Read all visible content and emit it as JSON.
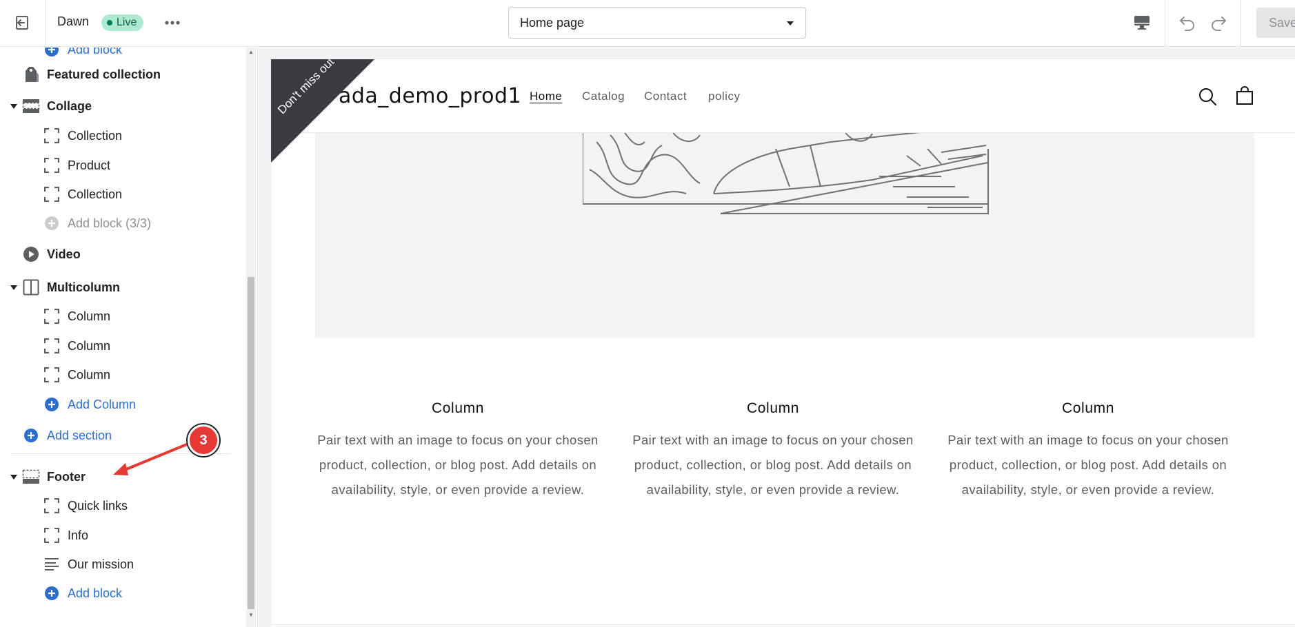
{
  "topbar": {
    "theme_name": "Dawn",
    "live_label": "Live",
    "page_select": "Home page",
    "save_label": "Save"
  },
  "sidebar": {
    "cut_item": "Add block",
    "featured_collection": "Featured collection",
    "collage": {
      "label": "Collage",
      "blocks": [
        "Collection",
        "Product",
        "Collection"
      ],
      "add_block": "Add block (3/3)"
    },
    "video": "Video",
    "multicolumn": {
      "label": "Multicolumn",
      "blocks": [
        "Column",
        "Column",
        "Column"
      ],
      "add_column": "Add Column"
    },
    "add_section": "Add section",
    "footer": {
      "label": "Footer",
      "blocks": [
        "Quick links",
        "Info",
        "Our mission"
      ],
      "add_block": "Add block"
    }
  },
  "annotation": {
    "number": "3"
  },
  "preview": {
    "ribbon_text": "Don't miss out",
    "store_name": "ada_demo_prod1",
    "nav": [
      "Home",
      "Catalog",
      "Contact",
      "policy"
    ],
    "columns": [
      {
        "title": "Column",
        "text": "Pair text with an image to focus on your chosen product, collection, or blog post. Add details on availability, style, or even provide a review."
      },
      {
        "title": "Column",
        "text": "Pair text with an image to focus on your chosen product, collection, or blog post. Add details on availability, style, or even provide a review."
      },
      {
        "title": "Column",
        "text": "Pair text with an image to focus on your chosen product, collection, or blog post. Add details on availability, style, or even provide a review."
      }
    ]
  },
  "colors": {
    "accent": "#2c6ecb",
    "live_badge": "#aee9d1",
    "ribbon": "#3b3a40",
    "annotation": "#e53935"
  }
}
